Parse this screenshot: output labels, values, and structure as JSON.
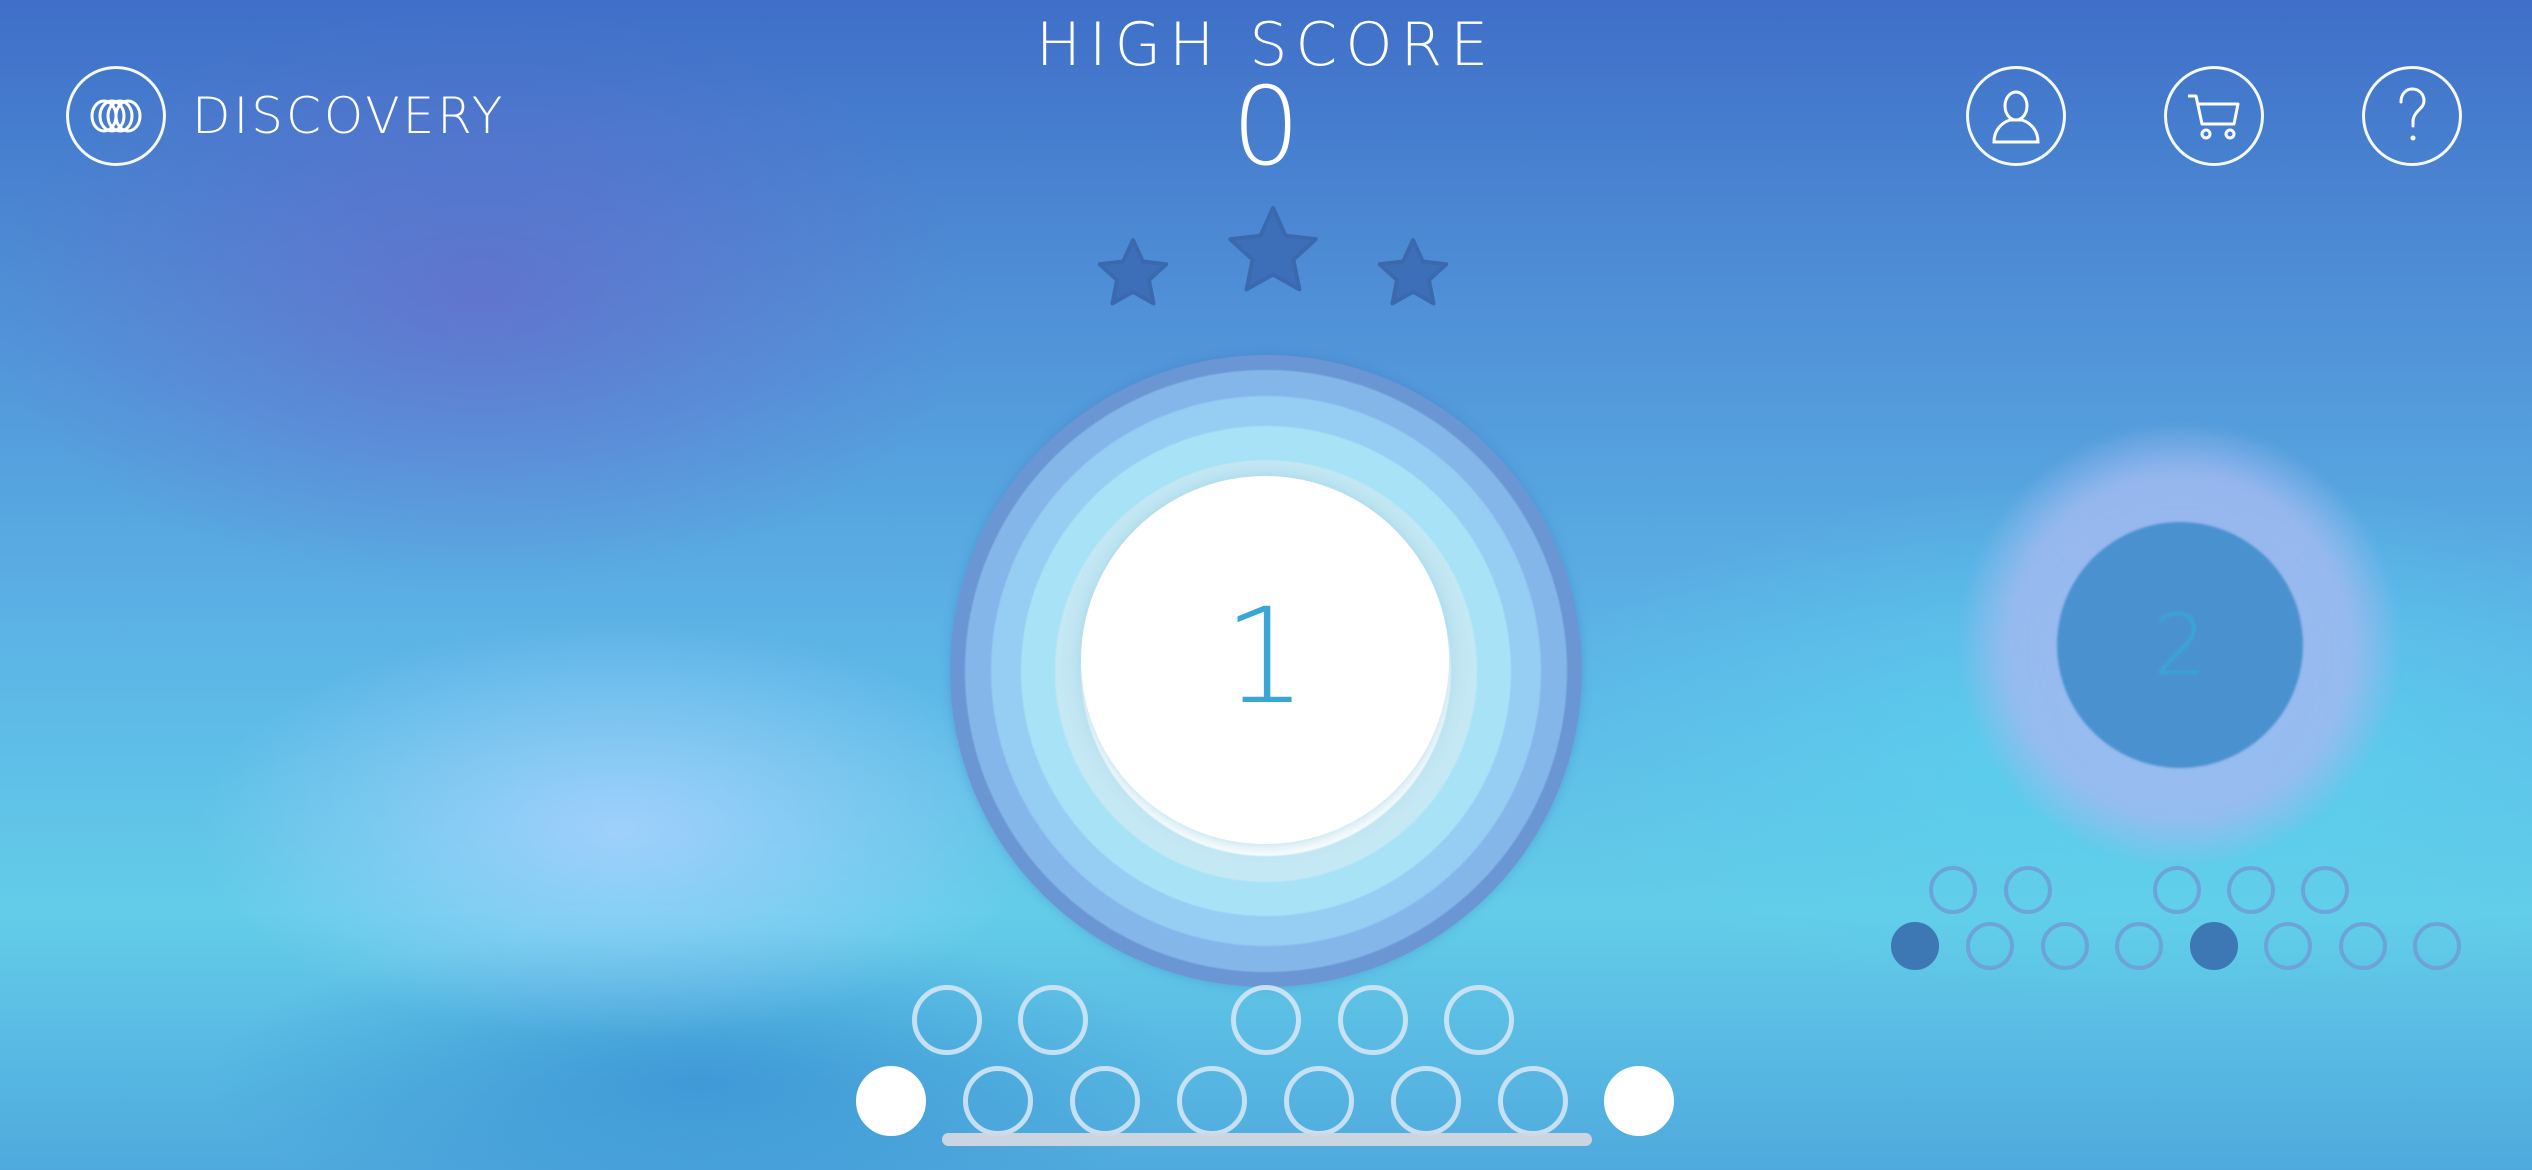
{
  "header": {
    "brand_label": "DISCOVERY",
    "brand_icon": "rings-logo-icon",
    "high_score_title": "HIGH SCORE",
    "high_score_value": "0",
    "buttons": [
      {
        "name": "profile",
        "icon": "person-icon"
      },
      {
        "name": "shop",
        "icon": "cart-icon"
      },
      {
        "name": "help",
        "icon": "question-icon"
      }
    ]
  },
  "level_stars": {
    "earned": 0,
    "total": 3
  },
  "levels": [
    {
      "number": "1",
      "state": "current"
    },
    {
      "number": "2",
      "state": "next"
    }
  ],
  "colors": {
    "star": "#3d6fb8",
    "inner_number": "#3aa6d8",
    "ring_outer": "#6a97d4"
  }
}
